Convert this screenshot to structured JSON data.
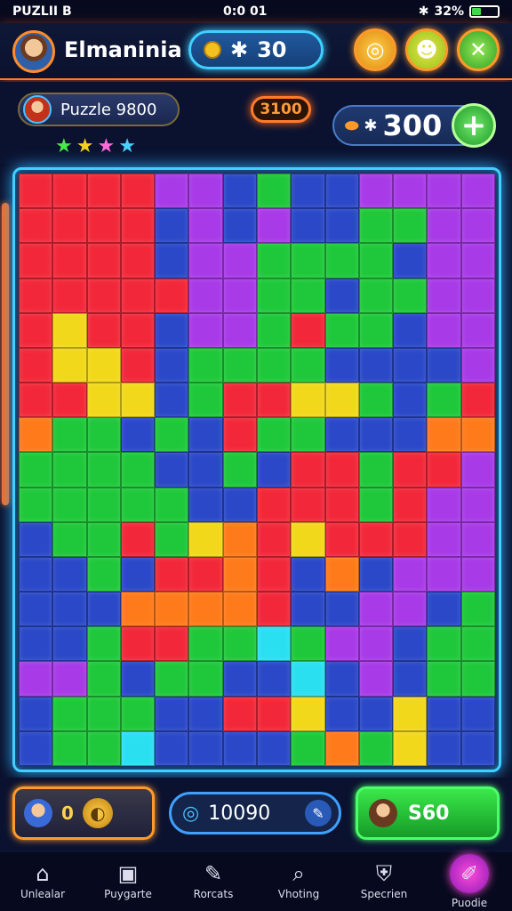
{
  "status_bar": {
    "carrier": "PUZLII B",
    "time": "0:0 01",
    "battery_text": "32%",
    "battery_level": 0.32
  },
  "header": {
    "player_name": "Elmaninia",
    "coins": "30"
  },
  "sub_header": {
    "puzzle_label": "Puzzle 9800",
    "orange_value": "3100",
    "score_value": "300"
  },
  "bottom_bar": {
    "left_value": "0",
    "middle_value": "10090",
    "right_value": "S60"
  },
  "nav": {
    "tabs": [
      {
        "label": "Unlealar",
        "icon": "home-icon"
      },
      {
        "label": "Puygarte",
        "icon": "puzzle-icon"
      },
      {
        "label": "Rorcats",
        "icon": "tasks-icon"
      },
      {
        "label": "Vhoting",
        "icon": "search-icon"
      },
      {
        "label": "Specrien",
        "icon": "shield-icon"
      },
      {
        "label": "Puodie",
        "icon": "brush-icon"
      }
    ]
  },
  "colors": {
    "accent": "#3fd0ff",
    "orange": "#ff7a2a",
    "green": "#3ddc4a"
  },
  "board": {
    "cols": 14,
    "rows": 17,
    "cells": [
      "RRRRMMBGBBMMMM",
      "RRRRBMBMBBGGMM",
      "RRRRBMMGGGGBMM",
      "RRRRRMMGGBGGMM",
      "RYRRBMMGRGGBMM",
      "RYYRBGGGGBBBBM",
      "RRYYBGRRYYGBGR",
      "OGGBGBRGGBBBOO",
      "GGGGBBGBRRGRRM",
      "GGGGGBBRRRGRMM",
      "BGGRGYORYRRRMM",
      "BBGBRRORBOBMMM",
      "BBBOOOORBBMMBG",
      "BBGRRGGCGMMBGG",
      "MMGBGGBBCBMBGG",
      "BGGGBBRRYBBYBB",
      "BGGCBBBBGOGYBB"
    ]
  }
}
